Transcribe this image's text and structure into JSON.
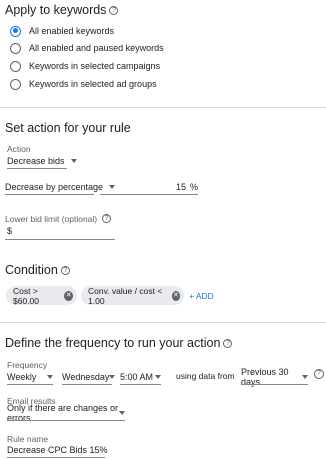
{
  "apply_section": {
    "title": "Apply to keywords",
    "options": [
      {
        "label": "All enabled keywords",
        "selected": true
      },
      {
        "label": "All enabled and paused keywords",
        "selected": false
      },
      {
        "label": "Keywords in selected campaigns",
        "selected": false
      },
      {
        "label": "Keywords in selected ad groups",
        "selected": false
      }
    ]
  },
  "action_section": {
    "title": "Set action for your rule",
    "action_label": "Action",
    "action_value": "Decrease bids",
    "adjust_value": "Decrease by percentage",
    "percent_value": "15",
    "percent_unit": "%",
    "limit_label": "Lower bid limit (optional)",
    "limit_prefix": "$"
  },
  "condition_section": {
    "title": "Condition",
    "chips": [
      "Cost > $60.00",
      "Conv. value / cost < 1.00"
    ],
    "add_label": "+ ADD"
  },
  "frequency_section": {
    "title": "Define the frequency to run your action",
    "frequency_label": "Frequency",
    "period": "Weekly",
    "day": "Wednesday",
    "time": "5:00 AM",
    "using_text": "using data from",
    "range": "Previous 30 days",
    "email_label": "Email results",
    "email_value": "Only if there are changes or errors",
    "name_label": "Rule name",
    "name_value": "Decrease CPC Bids 15%"
  },
  "colors": {
    "accent": "#1a73e8",
    "divider": "#dadce0",
    "chip": "#e8eaed"
  }
}
